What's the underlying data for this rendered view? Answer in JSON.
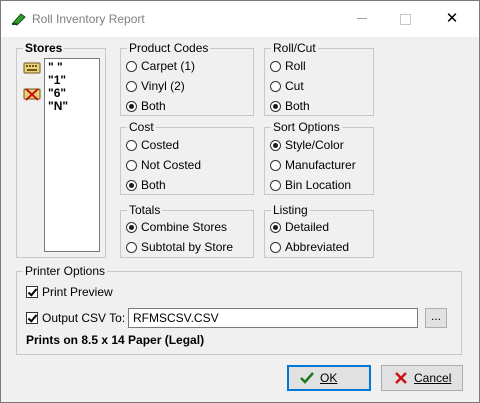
{
  "window": {
    "title": "Roll Inventory Report",
    "controls": {
      "minimize": "—",
      "maximize": "□",
      "close": "✕"
    }
  },
  "stores": {
    "label": "Stores",
    "items": [
      "\" \"",
      "\"1\"",
      "\"6\"",
      "\"N\""
    ],
    "icons": [
      "keyboard-icon",
      "clear-list-icon"
    ]
  },
  "product_codes": {
    "label": "Product Codes",
    "options": [
      "Carpet (1)",
      "Vinyl (2)",
      "Both"
    ],
    "selected": "Both"
  },
  "roll_cut": {
    "label": "Roll/Cut",
    "options": [
      "Roll",
      "Cut",
      "Both"
    ],
    "selected": "Both"
  },
  "cost": {
    "label": "Cost",
    "options": [
      "Costed",
      "Not Costed",
      "Both"
    ],
    "selected": "Both"
  },
  "sort_options": {
    "label": "Sort Options",
    "options": [
      "Style/Color",
      "Manufacturer",
      "Bin Location"
    ],
    "selected": "Style/Color"
  },
  "totals": {
    "label": "Totals",
    "options": [
      "Combine Stores",
      "Subtotal by Store"
    ],
    "selected": "Combine Stores"
  },
  "listing": {
    "label": "Listing",
    "options": [
      "Detailed",
      "Abbreviated"
    ],
    "selected": "Detailed"
  },
  "printer_options": {
    "label": "Printer Options",
    "print_preview_label": "Print Preview",
    "print_preview_checked": true,
    "output_csv_label": "Output CSV To:",
    "output_csv_checked": true,
    "csv_filename": "RFMSCSV.CSV",
    "browse_label": "...",
    "paper_note": "Prints on 8.5 x 14 Paper (Legal)"
  },
  "buttons": {
    "ok_label": "OK",
    "cancel_label": "Cancel"
  },
  "colors": {
    "accent": "#0078d7",
    "app_icon": "#2e9e2e",
    "cancel_icon": "#cc1111",
    "ok_icon": "#1a7a1a"
  }
}
